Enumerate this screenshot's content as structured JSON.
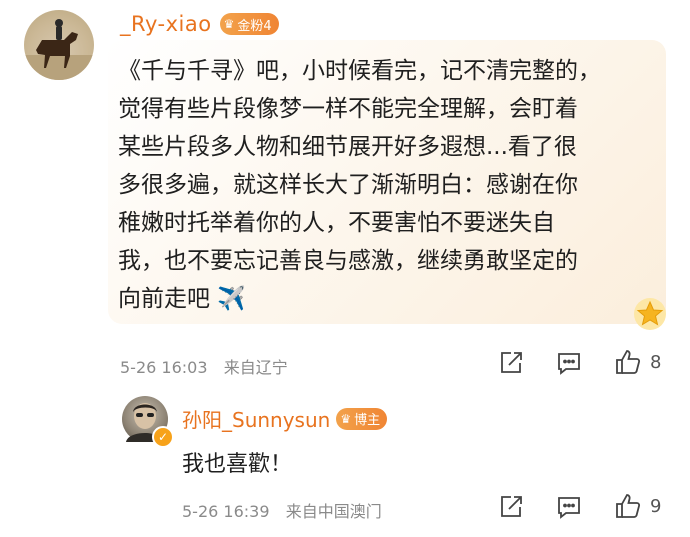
{
  "comment": {
    "username": "_Ry-xiao",
    "badge_label": "金粉4",
    "lines": [
      "《千与千寻》吧，小时候看完，记不清完整的，",
      "觉得有些片段像梦一样不能完全理解，会盯着",
      "某些片段多人物和细节展开好多遐想...看了很",
      "多很多遍，就这样长大了渐渐明白：感谢在你",
      "稚嫩时托举着你的人，不要害怕不要迷失自",
      "我，也不要忘记善良与感激，继续勇敢坚定的",
      "向前走吧 ✈️"
    ],
    "timestamp": "5-26 16:03",
    "location": "来自辽宁",
    "likes": "8"
  },
  "reply": {
    "username": "孙阳_Sunnysun",
    "badge_label": "博主",
    "text": "我也喜歡！",
    "timestamp": "5-26 16:39",
    "location": "来自中国澳门",
    "likes": "9"
  },
  "icons": [
    "share-icon",
    "comment-icon",
    "like-icon",
    "star-badge-icon",
    "airplane-emoji",
    "verified-icon"
  ],
  "colors": {
    "username": "#e8731f",
    "badge": "#f08534",
    "meta": "#8a8a8a"
  }
}
